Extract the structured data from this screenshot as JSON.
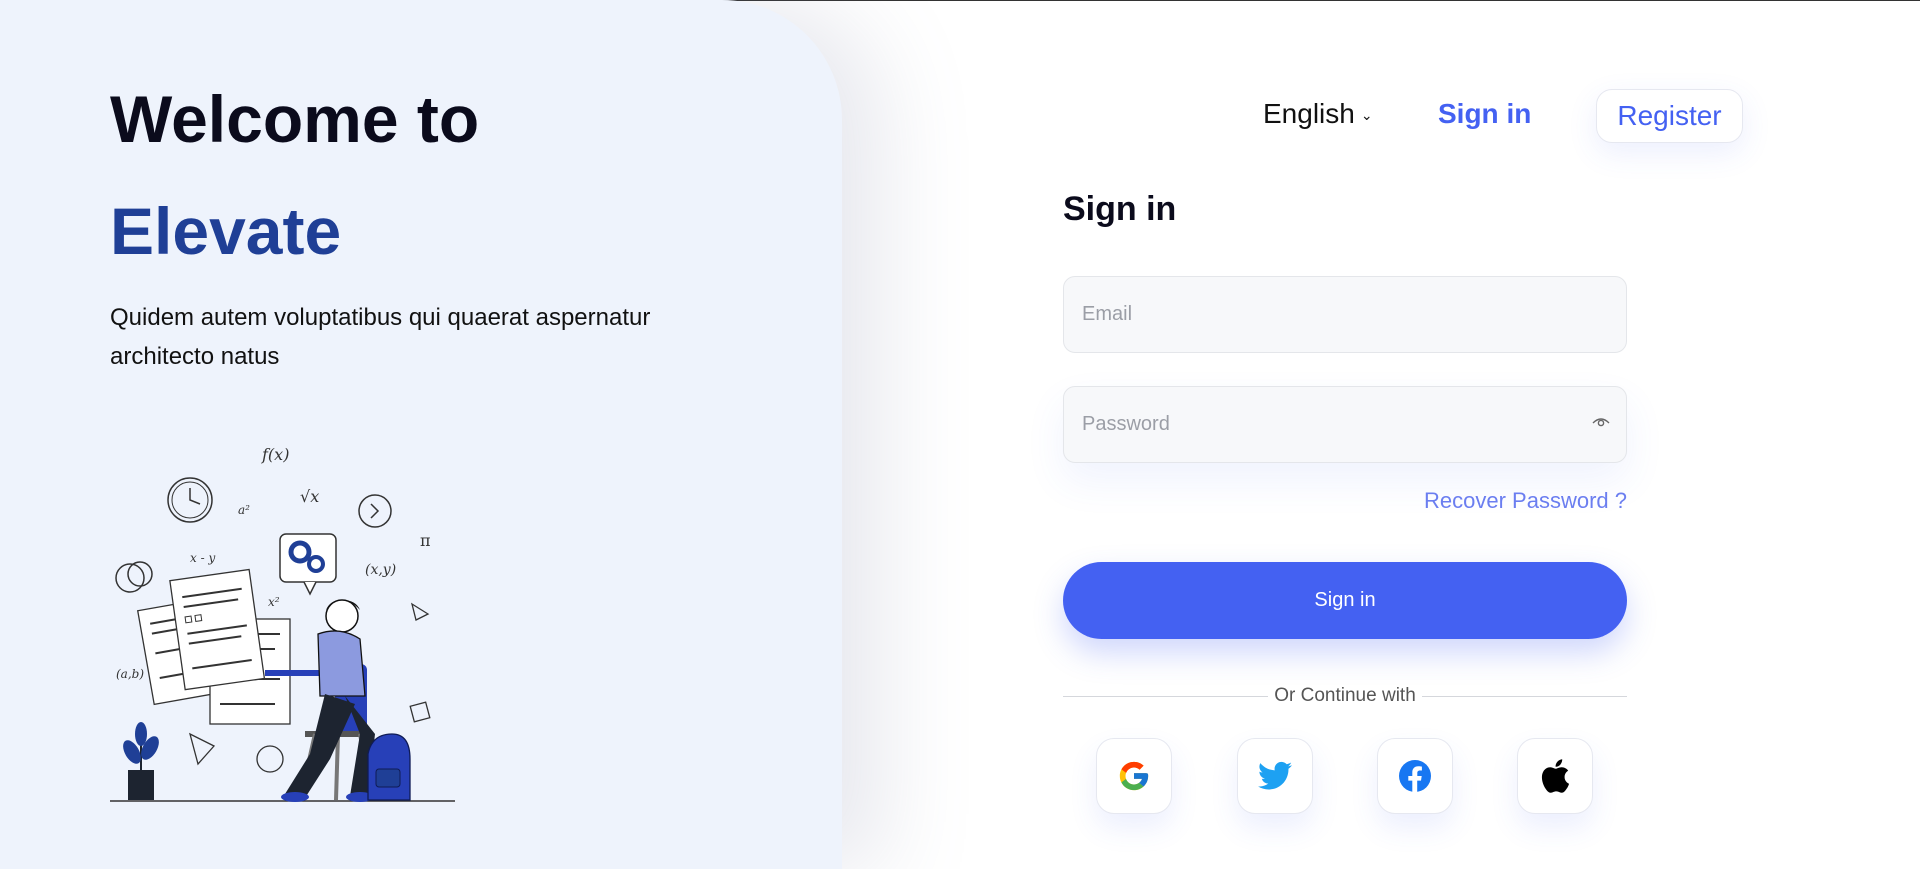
{
  "hero": {
    "welcome": "Welcome to",
    "brand": "Elevate",
    "subtitle": "Quidem autem voluptatibus qui quaerat aspernatur architecto natus"
  },
  "nav": {
    "language": "English",
    "signin": "Sign in",
    "register": "Register"
  },
  "form": {
    "title": "Sign in",
    "email_placeholder": "Email",
    "password_placeholder": "Password",
    "recover": "Recover Password ?",
    "submit": "Sign in",
    "divider": "Or Continue with"
  },
  "social": [
    "google-icon",
    "twitter-icon",
    "facebook-icon",
    "apple-icon"
  ],
  "colors": {
    "accent": "#4461f2",
    "brand": "#1f3f96",
    "panel": "#eef3fc"
  }
}
